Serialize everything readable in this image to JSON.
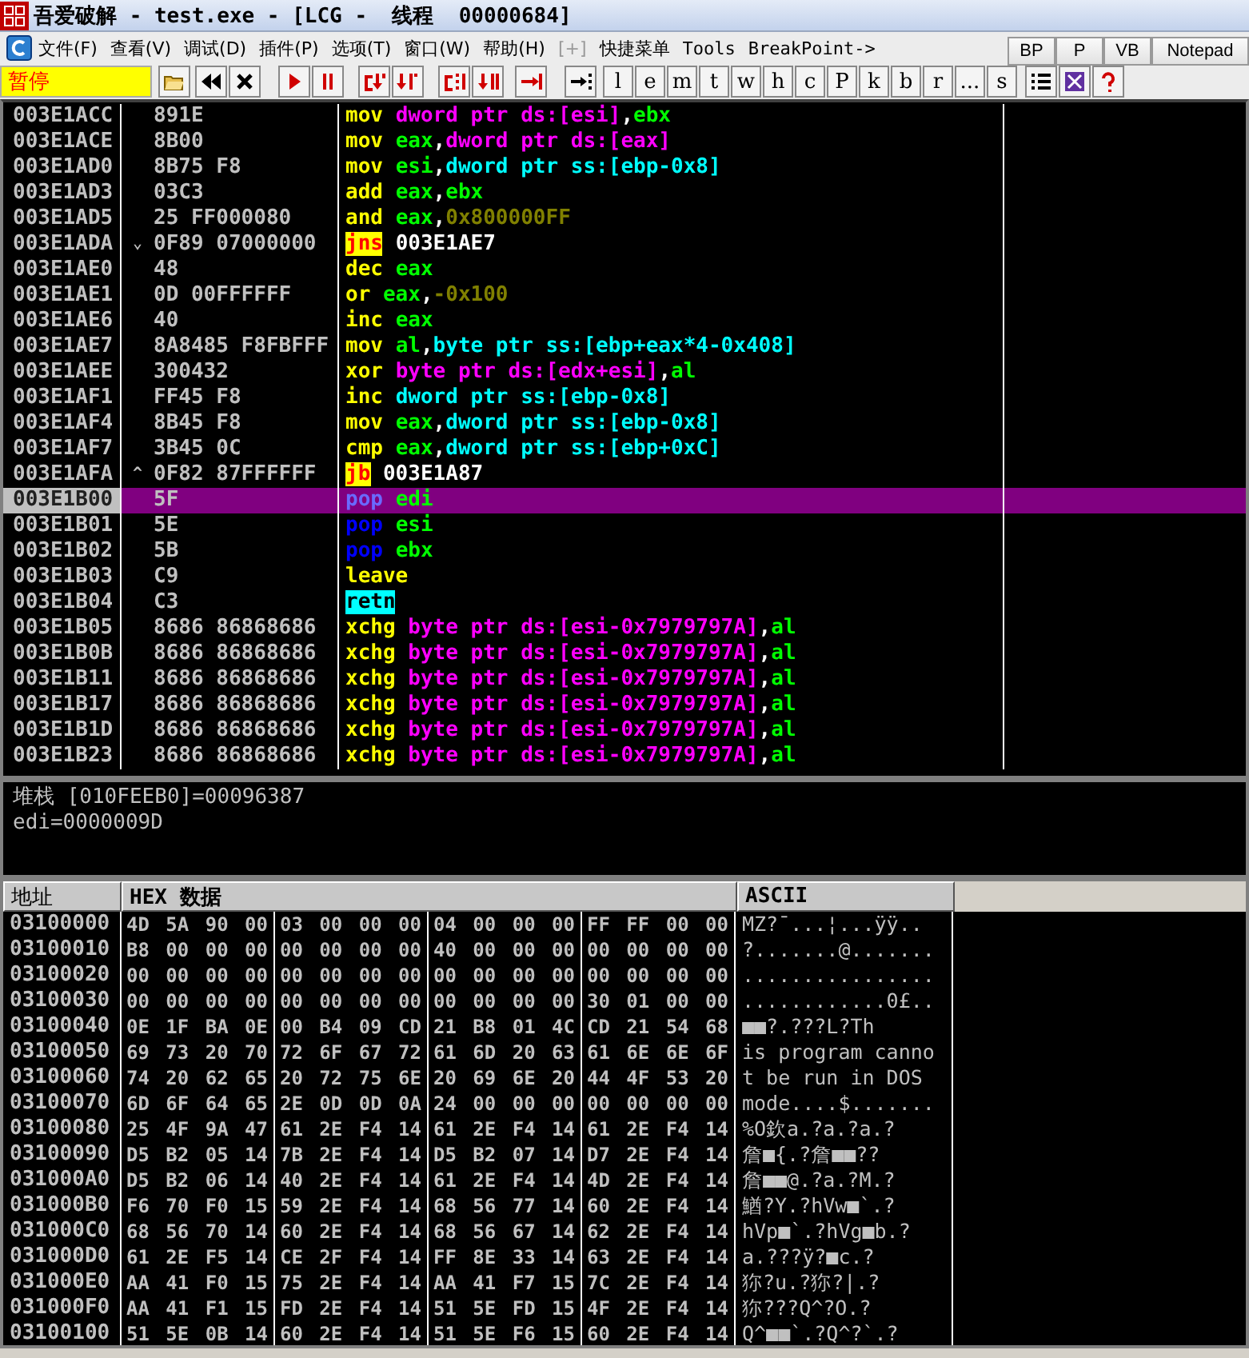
{
  "window": {
    "title": "吾爱破解 - test.exe - [LCG -  线程  00000684]"
  },
  "menu": [
    "文件(F)",
    "查看(V)",
    "调试(D)",
    "插件(P)",
    "选项(T)",
    "窗口(W)",
    "帮助(H)",
    "[+]",
    "快捷菜单",
    "Tools",
    "BreakPoint->"
  ],
  "quick_buttons": [
    "BP",
    "P",
    "VB",
    "Notepad"
  ],
  "toolbar": {
    "status": "暂停",
    "letters": [
      "l",
      "e",
      "m",
      "t",
      "w",
      "h",
      "c",
      "P",
      "k",
      "b",
      "r",
      "...",
      "s"
    ]
  },
  "disassembly": [
    {
      "address": "003E1ACC",
      "hex": "891E",
      "selected": false,
      "code": [
        {
          "kind": "op",
          "text": "mov"
        },
        {
          "kind": "dsmem",
          "text": "dword ptr ds:[esi]"
        },
        {
          "kind": "sep",
          "text": ","
        },
        {
          "kind": "reg",
          "text": "ebx"
        }
      ]
    },
    {
      "address": "003E1ACE",
      "hex": "8B00",
      "selected": false,
      "code": [
        {
          "kind": "op",
          "text": "mov"
        },
        {
          "kind": "reg",
          "text": "eax"
        },
        {
          "kind": "sep",
          "text": ","
        },
        {
          "kind": "dsmem",
          "text": "dword ptr ds:[eax]"
        }
      ]
    },
    {
      "address": "003E1AD0",
      "hex": "8B75 F8",
      "selected": false,
      "code": [
        {
          "kind": "op",
          "text": "mov"
        },
        {
          "kind": "reg",
          "text": "esi"
        },
        {
          "kind": "sep",
          "text": ","
        },
        {
          "kind": "ssmem",
          "text": "dword ptr ss:[ebp-0x8]"
        }
      ]
    },
    {
      "address": "003E1AD3",
      "hex": "03C3",
      "selected": false,
      "code": [
        {
          "kind": "op",
          "text": "add"
        },
        {
          "kind": "reg",
          "text": "eax"
        },
        {
          "kind": "sep",
          "text": ","
        },
        {
          "kind": "reg",
          "text": "ebx"
        }
      ]
    },
    {
      "address": "003E1AD5",
      "hex": "25 FF000080",
      "selected": false,
      "code": [
        {
          "kind": "op",
          "text": "and"
        },
        {
          "kind": "reg",
          "text": "eax"
        },
        {
          "kind": "sep",
          "text": ","
        },
        {
          "kind": "imm",
          "text": "0x800000FF"
        }
      ]
    },
    {
      "address": "003E1ADA",
      "mark": "⌄",
      "hex": "0F89 07000000",
      "selected": false,
      "code": [
        {
          "kind": "jump",
          "text": "jns"
        },
        {
          "kind": "target",
          "text": "003E1AE7"
        }
      ]
    },
    {
      "address": "003E1AE0",
      "hex": "48",
      "selected": false,
      "code": [
        {
          "kind": "op",
          "text": "dec"
        },
        {
          "kind": "reg",
          "text": "eax"
        }
      ]
    },
    {
      "address": "003E1AE1",
      "hex": "0D 00FFFFFF",
      "selected": false,
      "code": [
        {
          "kind": "op",
          "text": "or"
        },
        {
          "kind": "reg",
          "text": "eax"
        },
        {
          "kind": "sep",
          "text": ","
        },
        {
          "kind": "imm",
          "text": "-0x100"
        }
      ]
    },
    {
      "address": "003E1AE6",
      "hex": "40",
      "selected": false,
      "code": [
        {
          "kind": "op",
          "text": "inc"
        },
        {
          "kind": "reg",
          "text": "eax"
        }
      ]
    },
    {
      "address": "003E1AE7",
      "hex": "8A8485 F8FBFFF",
      "selected": false,
      "code": [
        {
          "kind": "op",
          "text": "mov"
        },
        {
          "kind": "reg",
          "text": "al"
        },
        {
          "kind": "sep",
          "text": ","
        },
        {
          "kind": "ssmem",
          "text": "byte ptr ss:[ebp+eax*4-0x408]"
        }
      ]
    },
    {
      "address": "003E1AEE",
      "hex": "300432",
      "selected": false,
      "code": [
        {
          "kind": "op",
          "text": "xor"
        },
        {
          "kind": "dsmem",
          "text": "byte ptr ds:[edx+esi]"
        },
        {
          "kind": "sep",
          "text": ","
        },
        {
          "kind": "reg",
          "text": "al"
        }
      ]
    },
    {
      "address": "003E1AF1",
      "hex": "FF45 F8",
      "selected": false,
      "code": [
        {
          "kind": "op",
          "text": "inc"
        },
        {
          "kind": "ssmem",
          "text": "dword ptr ss:[ebp-0x8]"
        }
      ]
    },
    {
      "address": "003E1AF4",
      "hex": "8B45 F8",
      "selected": false,
      "code": [
        {
          "kind": "op",
          "text": "mov"
        },
        {
          "kind": "reg",
          "text": "eax"
        },
        {
          "kind": "sep",
          "text": ","
        },
        {
          "kind": "ssmem",
          "text": "dword ptr ss:[ebp-0x8]"
        }
      ]
    },
    {
      "address": "003E1AF7",
      "hex": "3B45 0C",
      "selected": false,
      "code": [
        {
          "kind": "op",
          "text": "cmp"
        },
        {
          "kind": "reg",
          "text": "eax"
        },
        {
          "kind": "sep",
          "text": ","
        },
        {
          "kind": "ssmem",
          "text": "dword ptr ss:[ebp+0xC]"
        }
      ]
    },
    {
      "address": "003E1AFA",
      "mark": "^",
      "hex": "0F82 87FFFFFF",
      "selected": false,
      "code": [
        {
          "kind": "jump",
          "text": "jb"
        },
        {
          "kind": "target",
          "text": "003E1A87"
        }
      ]
    },
    {
      "address": "003E1B00",
      "hex": "5F",
      "selected": true,
      "code": [
        {
          "kind": "stack",
          "text": "pop"
        },
        {
          "kind": "reg",
          "text": "edi"
        }
      ]
    },
    {
      "address": "003E1B01",
      "hex": "5E",
      "selected": false,
      "code": [
        {
          "kind": "stack",
          "text": "pop"
        },
        {
          "kind": "reg",
          "text": "esi"
        }
      ]
    },
    {
      "address": "003E1B02",
      "hex": "5B",
      "selected": false,
      "code": [
        {
          "kind": "stack",
          "text": "pop"
        },
        {
          "kind": "reg",
          "text": "ebx"
        }
      ]
    },
    {
      "address": "003E1B03",
      "hex": "C9",
      "selected": false,
      "code": [
        {
          "kind": "op",
          "text": "leave"
        }
      ]
    },
    {
      "address": "003E1B04",
      "hex": "C3",
      "selected": false,
      "code": [
        {
          "kind": "ret",
          "text": "retn"
        }
      ]
    },
    {
      "address": "003E1B05",
      "hex": "8686 86868686",
      "selected": false,
      "code": [
        {
          "kind": "op",
          "text": "xchg"
        },
        {
          "kind": "dsmem",
          "text": "byte ptr ds:[esi-0x7979797A]"
        },
        {
          "kind": "sep",
          "text": ","
        },
        {
          "kind": "reg",
          "text": "al"
        }
      ]
    },
    {
      "address": "003E1B0B",
      "hex": "8686 86868686",
      "selected": false,
      "code": [
        {
          "kind": "op",
          "text": "xchg"
        },
        {
          "kind": "dsmem",
          "text": "byte ptr ds:[esi-0x7979797A]"
        },
        {
          "kind": "sep",
          "text": ","
        },
        {
          "kind": "reg",
          "text": "al"
        }
      ]
    },
    {
      "address": "003E1B11",
      "hex": "8686 86868686",
      "selected": false,
      "code": [
        {
          "kind": "op",
          "text": "xchg"
        },
        {
          "kind": "dsmem",
          "text": "byte ptr ds:[esi-0x7979797A]"
        },
        {
          "kind": "sep",
          "text": ","
        },
        {
          "kind": "reg",
          "text": "al"
        }
      ]
    },
    {
      "address": "003E1B17",
      "hex": "8686 86868686",
      "selected": false,
      "code": [
        {
          "kind": "op",
          "text": "xchg"
        },
        {
          "kind": "dsmem",
          "text": "byte ptr ds:[esi-0x7979797A]"
        },
        {
          "kind": "sep",
          "text": ","
        },
        {
          "kind": "reg",
          "text": "al"
        }
      ]
    },
    {
      "address": "003E1B1D",
      "hex": "8686 86868686",
      "selected": false,
      "code": [
        {
          "kind": "op",
          "text": "xchg"
        },
        {
          "kind": "dsmem",
          "text": "byte ptr ds:[esi-0x7979797A]"
        },
        {
          "kind": "sep",
          "text": ","
        },
        {
          "kind": "reg",
          "text": "al"
        }
      ]
    },
    {
      "address": "003E1B23",
      "hex": "8686 86868686",
      "selected": false,
      "code": [
        {
          "kind": "op",
          "text": "xchg"
        },
        {
          "kind": "dsmem",
          "text": "byte ptr ds:[esi-0x7979797A]"
        },
        {
          "kind": "sep",
          "text": ","
        },
        {
          "kind": "reg",
          "text": "al"
        }
      ]
    }
  ],
  "info": [
    "堆栈 [010FEEB0]=00096387",
    "edi=0000009D"
  ],
  "dump": {
    "columns": [
      "地址",
      "HEX 数据",
      "ASCII"
    ],
    "rows": [
      {
        "address": "03100000",
        "hex": [
          "4D 5A 90 00",
          "03 00 00 00",
          "04 00 00 00",
          "FF FF 00 00"
        ],
        "ascii": "MZ?¯...¦...ÿÿ.."
      },
      {
        "address": "03100010",
        "hex": [
          "B8 00 00 00",
          "00 00 00 00",
          "40 00 00 00",
          "00 00 00 00"
        ],
        "ascii": "?.......@......."
      },
      {
        "address": "03100020",
        "hex": [
          "00 00 00 00",
          "00 00 00 00",
          "00 00 00 00",
          "00 00 00 00"
        ],
        "ascii": "................"
      },
      {
        "address": "03100030",
        "hex": [
          "00 00 00 00",
          "00 00 00 00",
          "00 00 00 00",
          "30 01 00 00"
        ],
        "ascii": "............0£.."
      },
      {
        "address": "03100040",
        "hex": [
          "0E 1F BA 0E",
          "00 B4 09 CD",
          "21 B8 01 4C",
          "CD 21 54 68"
        ],
        "ascii": "■■?.???L?Th"
      },
      {
        "address": "03100050",
        "hex": [
          "69 73 20 70",
          "72 6F 67 72",
          "61 6D 20 63",
          "61 6E 6E 6F"
        ],
        "ascii": "is program canno"
      },
      {
        "address": "03100060",
        "hex": [
          "74 20 62 65",
          "20 72 75 6E",
          "20 69 6E 20",
          "44 4F 53 20"
        ],
        "ascii": "t be run in DOS"
      },
      {
        "address": "03100070",
        "hex": [
          "6D 6F 64 65",
          "2E 0D 0D 0A",
          "24 00 00 00",
          "00 00 00 00"
        ],
        "ascii": "mode....$......."
      },
      {
        "address": "03100080",
        "hex": [
          "25 4F 9A 47",
          "61 2E F4 14",
          "61 2E F4 14",
          "61 2E F4 14"
        ],
        "ascii": "%O欽a.?a.?a.?"
      },
      {
        "address": "03100090",
        "hex": [
          "D5 B2 05 14",
          "7B 2E F4 14",
          "D5 B2 07 14",
          "D7 2E F4 14"
        ],
        "ascii": "詹■{.?詹■■??"
      },
      {
        "address": "031000A0",
        "hex": [
          "D5 B2 06 14",
          "40 2E F4 14",
          "61 2E F4 14",
          "4D 2E F4 14"
        ],
        "ascii": "詹■■@.?a.?M.?"
      },
      {
        "address": "031000B0",
        "hex": [
          "F6 70 F0 15",
          "59 2E F4 14",
          "68 56 77 14",
          "60 2E F4 14"
        ],
        "ascii": "鰌?Y.?hVw■`.?"
      },
      {
        "address": "031000C0",
        "hex": [
          "68 56 70 14",
          "60 2E F4 14",
          "68 56 67 14",
          "62 2E F4 14"
        ],
        "ascii": "hVp■`.?hVg■b.?"
      },
      {
        "address": "031000D0",
        "hex": [
          "61 2E F5 14",
          "CE 2F F4 14",
          "FF 8E 33 14",
          "63 2E F4 14"
        ],
        "ascii": "a.???ÿ?■c.?"
      },
      {
        "address": "031000E0",
        "hex": [
          "AA 41 F0 15",
          "75 2E F4 14",
          "AA 41 F7 15",
          "7C 2E F4 14"
        ],
        "ascii": "狝?u.?狝?|.?"
      },
      {
        "address": "031000F0",
        "hex": [
          "AA 41 F1 15",
          "FD 2E F4 14",
          "51 5E FD 15",
          "4F 2E F4 14"
        ],
        "ascii": "狝???Q^?O.?"
      },
      {
        "address": "03100100",
        "hex": [
          "51 5E 0B 14",
          "60 2E F4 14",
          "51 5E F6 15",
          "60 2E F4 14"
        ],
        "ascii": "Q^■■`.?Q^?`.?"
      }
    ]
  }
}
